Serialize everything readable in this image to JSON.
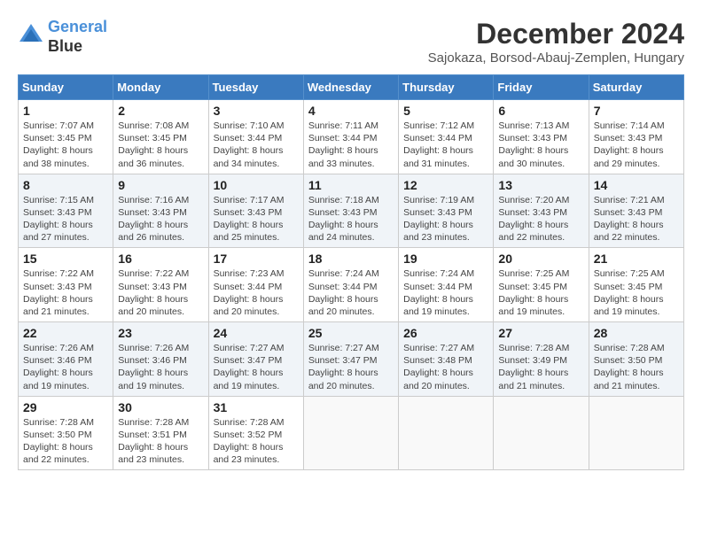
{
  "header": {
    "logo_line1": "General",
    "logo_line2": "Blue",
    "month_year": "December 2024",
    "location": "Sajokaza, Borsod-Abauj-Zemplen, Hungary"
  },
  "days_of_week": [
    "Sunday",
    "Monday",
    "Tuesday",
    "Wednesday",
    "Thursday",
    "Friday",
    "Saturday"
  ],
  "weeks": [
    [
      {
        "day": 1,
        "sunrise": "7:07 AM",
        "sunset": "3:45 PM",
        "daylight": "8 hours and 38 minutes"
      },
      {
        "day": 2,
        "sunrise": "7:08 AM",
        "sunset": "3:45 PM",
        "daylight": "8 hours and 36 minutes"
      },
      {
        "day": 3,
        "sunrise": "7:10 AM",
        "sunset": "3:44 PM",
        "daylight": "8 hours and 34 minutes"
      },
      {
        "day": 4,
        "sunrise": "7:11 AM",
        "sunset": "3:44 PM",
        "daylight": "8 hours and 33 minutes"
      },
      {
        "day": 5,
        "sunrise": "7:12 AM",
        "sunset": "3:44 PM",
        "daylight": "8 hours and 31 minutes"
      },
      {
        "day": 6,
        "sunrise": "7:13 AM",
        "sunset": "3:43 PM",
        "daylight": "8 hours and 30 minutes"
      },
      {
        "day": 7,
        "sunrise": "7:14 AM",
        "sunset": "3:43 PM",
        "daylight": "8 hours and 29 minutes"
      }
    ],
    [
      {
        "day": 8,
        "sunrise": "7:15 AM",
        "sunset": "3:43 PM",
        "daylight": "8 hours and 27 minutes"
      },
      {
        "day": 9,
        "sunrise": "7:16 AM",
        "sunset": "3:43 PM",
        "daylight": "8 hours and 26 minutes"
      },
      {
        "day": 10,
        "sunrise": "7:17 AM",
        "sunset": "3:43 PM",
        "daylight": "8 hours and 25 minutes"
      },
      {
        "day": 11,
        "sunrise": "7:18 AM",
        "sunset": "3:43 PM",
        "daylight": "8 hours and 24 minutes"
      },
      {
        "day": 12,
        "sunrise": "7:19 AM",
        "sunset": "3:43 PM",
        "daylight": "8 hours and 23 minutes"
      },
      {
        "day": 13,
        "sunrise": "7:20 AM",
        "sunset": "3:43 PM",
        "daylight": "8 hours and 22 minutes"
      },
      {
        "day": 14,
        "sunrise": "7:21 AM",
        "sunset": "3:43 PM",
        "daylight": "8 hours and 22 minutes"
      }
    ],
    [
      {
        "day": 15,
        "sunrise": "7:22 AM",
        "sunset": "3:43 PM",
        "daylight": "8 hours and 21 minutes"
      },
      {
        "day": 16,
        "sunrise": "7:22 AM",
        "sunset": "3:43 PM",
        "daylight": "8 hours and 20 minutes"
      },
      {
        "day": 17,
        "sunrise": "7:23 AM",
        "sunset": "3:44 PM",
        "daylight": "8 hours and 20 minutes"
      },
      {
        "day": 18,
        "sunrise": "7:24 AM",
        "sunset": "3:44 PM",
        "daylight": "8 hours and 20 minutes"
      },
      {
        "day": 19,
        "sunrise": "7:24 AM",
        "sunset": "3:44 PM",
        "daylight": "8 hours and 19 minutes"
      },
      {
        "day": 20,
        "sunrise": "7:25 AM",
        "sunset": "3:45 PM",
        "daylight": "8 hours and 19 minutes"
      },
      {
        "day": 21,
        "sunrise": "7:25 AM",
        "sunset": "3:45 PM",
        "daylight": "8 hours and 19 minutes"
      }
    ],
    [
      {
        "day": 22,
        "sunrise": "7:26 AM",
        "sunset": "3:46 PM",
        "daylight": "8 hours and 19 minutes"
      },
      {
        "day": 23,
        "sunrise": "7:26 AM",
        "sunset": "3:46 PM",
        "daylight": "8 hours and 19 minutes"
      },
      {
        "day": 24,
        "sunrise": "7:27 AM",
        "sunset": "3:47 PM",
        "daylight": "8 hours and 19 minutes"
      },
      {
        "day": 25,
        "sunrise": "7:27 AM",
        "sunset": "3:47 PM",
        "daylight": "8 hours and 20 minutes"
      },
      {
        "day": 26,
        "sunrise": "7:27 AM",
        "sunset": "3:48 PM",
        "daylight": "8 hours and 20 minutes"
      },
      {
        "day": 27,
        "sunrise": "7:28 AM",
        "sunset": "3:49 PM",
        "daylight": "8 hours and 21 minutes"
      },
      {
        "day": 28,
        "sunrise": "7:28 AM",
        "sunset": "3:50 PM",
        "daylight": "8 hours and 21 minutes"
      }
    ],
    [
      {
        "day": 29,
        "sunrise": "7:28 AM",
        "sunset": "3:50 PM",
        "daylight": "8 hours and 22 minutes"
      },
      {
        "day": 30,
        "sunrise": "7:28 AM",
        "sunset": "3:51 PM",
        "daylight": "8 hours and 23 minutes"
      },
      {
        "day": 31,
        "sunrise": "7:28 AM",
        "sunset": "3:52 PM",
        "daylight": "8 hours and 23 minutes"
      },
      null,
      null,
      null,
      null
    ]
  ]
}
